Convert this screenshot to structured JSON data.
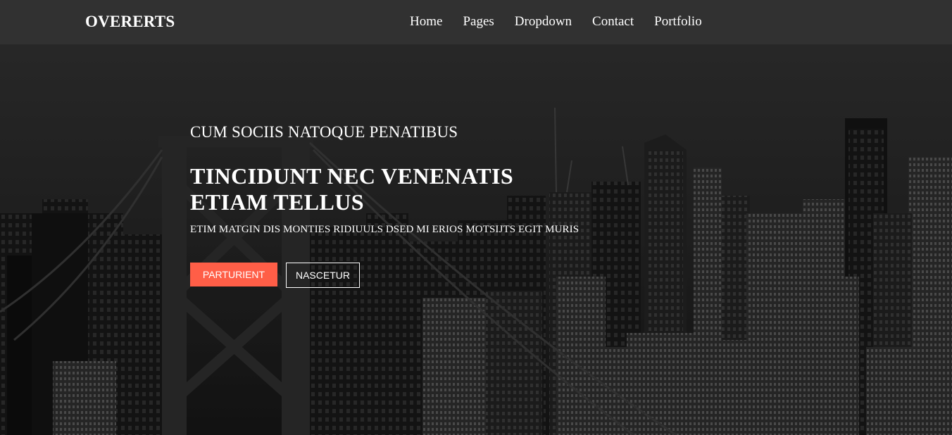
{
  "brand": "OVERERTS",
  "nav": {
    "items": [
      {
        "label": "Home"
      },
      {
        "label": "Pages"
      },
      {
        "label": "Dropdown"
      },
      {
        "label": "Contact"
      },
      {
        "label": "Portfolio"
      }
    ]
  },
  "hero": {
    "kicker": "CUM SOCIIS NATOQUE PENATIBUS",
    "title_line1": "TINCIDUNT NEC VENENATIS",
    "title_line2": "ETIAM TELLUS",
    "subtitle": "ETIM MATGIN DIS MONTIES RIDIUULS DSED MI ERIOS MOTSIJTS EGIT MURIS",
    "primary_button": "PARTURIENT",
    "secondary_button": "NASCETUR"
  },
  "colors": {
    "navbar_bg": "#313131",
    "accent": "#ff5e47",
    "text": "#ffffff"
  }
}
